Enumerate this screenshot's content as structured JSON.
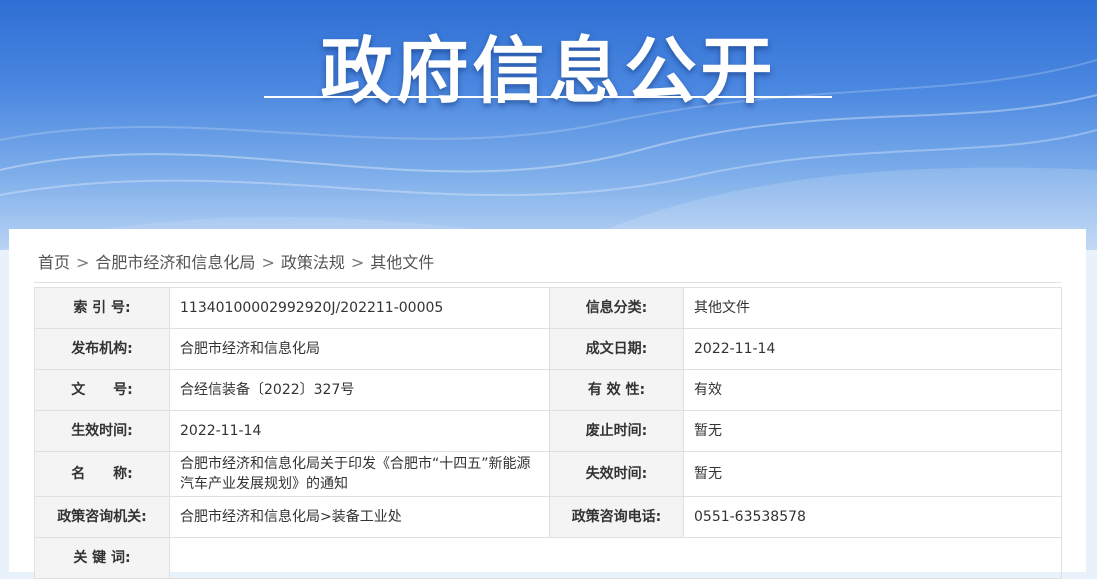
{
  "banner": {
    "title": "政府信息公开"
  },
  "breadcrumb": [
    "首页",
    "合肥市经济和信息化局",
    "政策法规",
    "其他文件"
  ],
  "breadcrumb_sep": ">",
  "info": {
    "index_label": "索 引 号:",
    "index_value": "11340100002992920J/202211-00005",
    "category_label": "信息分类:",
    "category_value": "其他文件",
    "publisher_label": "发布机构:",
    "publisher_value": "合肥市经济和信息化局",
    "date_label": "成文日期:",
    "date_value": "2022-11-14",
    "docno_label": "文　　号:",
    "docno_value": "合经信装备〔2022〕327号",
    "validity_label": "有 效 性:",
    "validity_value": "有效",
    "effective_label": "生效时间:",
    "effective_value": "2022-11-14",
    "repeal_label": "废止时间:",
    "repeal_value": "暂无",
    "name_label": "名　　称:",
    "name_value": "合肥市经济和信息化局关于印发《合肥市“十四五”新能源汽车产业发展规划》的通知",
    "expire_label": "失效时间:",
    "expire_value": "暂无",
    "consult_org_label": "政策咨询机关:",
    "consult_org_value": "合肥市经济和信息化局>装备工业处",
    "consult_tel_label": "政策咨询电话:",
    "consult_tel_value": "0551-63538578",
    "keywords_label": "关 键 词:",
    "keywords_value": ""
  }
}
